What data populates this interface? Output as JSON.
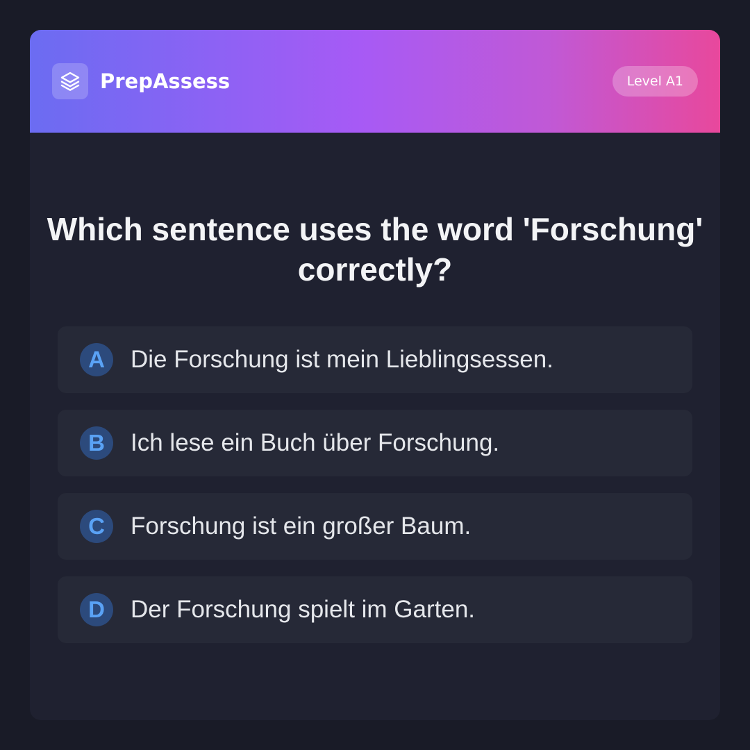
{
  "header": {
    "logo_icon": "layers-icon",
    "brand": "PrepAssess",
    "level_badge": "Level A1",
    "gradient_colors": [
      "#6b6cf2",
      "#a75af5",
      "#e8489c"
    ]
  },
  "question": {
    "text": "Which sentence uses the word 'Forschung' correctly?"
  },
  "options": [
    {
      "letter": "A",
      "text": "Die Forschung ist mein Lieblingsessen."
    },
    {
      "letter": "B",
      "text": "Ich lese ein Buch über Forschung."
    },
    {
      "letter": "C",
      "text": "Forschung ist ein großer Baum."
    },
    {
      "letter": "D",
      "text": "Der Forschung spielt im Garten."
    }
  ],
  "colors": {
    "background": "#191b27",
    "card": "#1f2130",
    "option_bg": "#262937",
    "letter_circle": "#2c4a7c",
    "letter_text": "#5aa2f5"
  }
}
